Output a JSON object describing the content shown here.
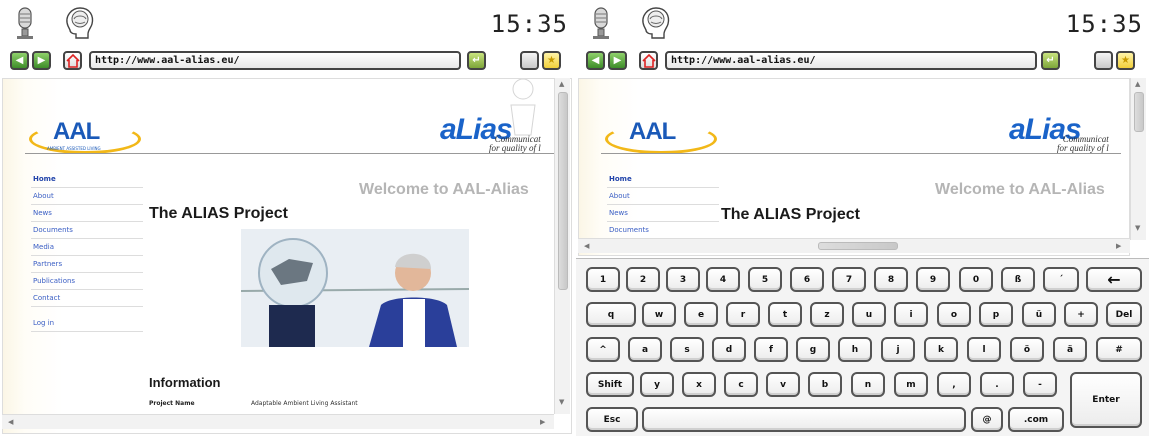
{
  "left_panel": {
    "clock": "15:35",
    "url": "http://www.aal-alias.eu/",
    "logos": {
      "aal": "AAL",
      "aal_sub": "AMBIENT ASSISTED LIVING",
      "alias": "aLias",
      "alias_tag_1": "Communicat",
      "alias_tag_2": "for quality of l"
    },
    "nav": [
      "Home",
      "About",
      "News",
      "Documents",
      "Media",
      "Partners",
      "Publications",
      "Contact"
    ],
    "login": "Log in",
    "welcome": "Welcome to AAL-Alias",
    "project_title": "The ALIAS Project",
    "info_title": "Information",
    "info_key": "Project Name",
    "info_value": "Adaptable Ambient Living Assistant"
  },
  "right_panel": {
    "clock": "15:35",
    "url": "http://www.aal-alias.eu/",
    "logos": {
      "aal": "AAL",
      "alias": "aLias",
      "alias_tag_1": "Communicat",
      "alias_tag_2": "for quality of l"
    },
    "nav": [
      "Home",
      "About",
      "News",
      "Documents"
    ],
    "welcome": "Welcome to AAL-Alias",
    "project_title": "The ALIAS Project"
  },
  "keyboard": {
    "row1": [
      "1",
      "2",
      "3",
      "4",
      "5",
      "6",
      "7",
      "8",
      "9",
      "0",
      "ß",
      "´",
      "←"
    ],
    "row2": [
      "q",
      "w",
      "e",
      "r",
      "t",
      "z",
      "u",
      "i",
      "o",
      "p",
      "ü",
      "+",
      "Del"
    ],
    "row3": [
      "^",
      "a",
      "s",
      "d",
      "f",
      "g",
      "h",
      "j",
      "k",
      "l",
      "ö",
      "ä",
      "#"
    ],
    "row4": [
      "Shift",
      "y",
      "x",
      "c",
      "v",
      "b",
      "n",
      "m",
      ",",
      ".",
      "-"
    ],
    "enter": "Enter",
    "esc": "Esc",
    "at": "@",
    "com": ".com"
  },
  "icons": [
    "microphone-icon",
    "brain-head-icon",
    "back-arrow-icon",
    "forward-arrow-icon",
    "home-icon",
    "go-icon",
    "blank-icon",
    "star-icon"
  ],
  "colors": {
    "nav_green": "#3e8d2a",
    "link_blue": "#3a5ec4",
    "brand_blue": "#1a59b8",
    "brand_yellow": "#f2b818"
  }
}
